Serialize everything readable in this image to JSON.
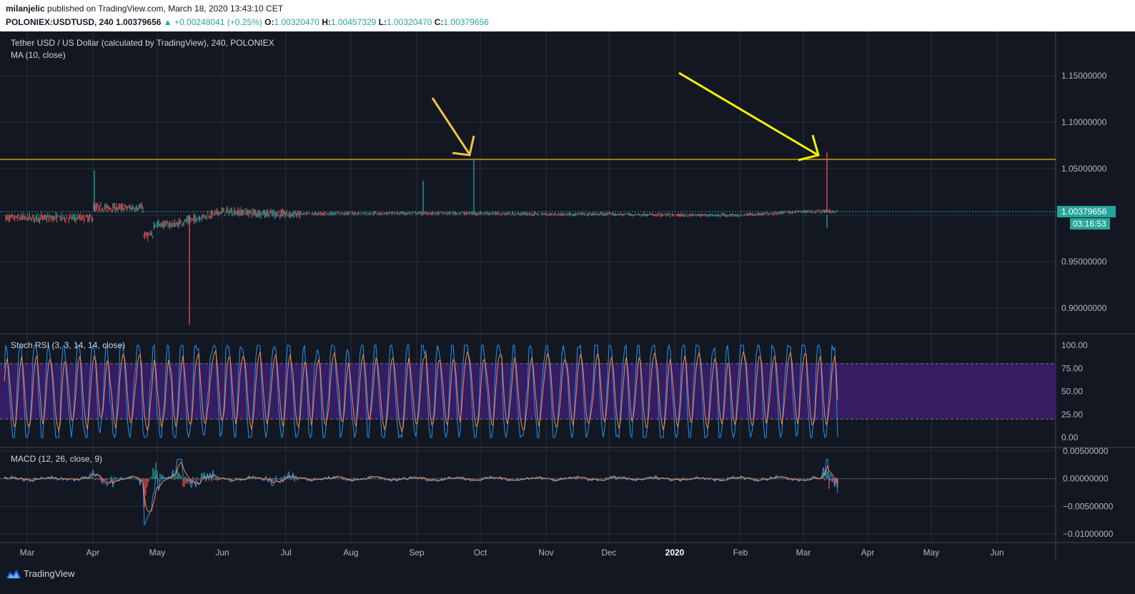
{
  "header": {
    "author": "milanjelic",
    "published_text": "published on TradingView.com, March 18, 2020 13:43:10 CET",
    "symbol": "POLONIEX:USDTUSD, 240",
    "last_price": "1.00379656",
    "change_arrow": "▲",
    "change": "+0.00248041 (+0.25%)",
    "ohlc": [
      {
        "label": "O:",
        "value": "1.00320470"
      },
      {
        "label": "H:",
        "value": "1.00457329"
      },
      {
        "label": "L:",
        "value": "1.00320470"
      },
      {
        "label": "C:",
        "value": "1.00379656"
      }
    ]
  },
  "main_pane": {
    "title": "Tether USD / US Dollar (calculated by TradingView), 240, POLONIEX",
    "indicator": "MA (10, close)",
    "price_labels": [
      "1.15000000",
      "1.10000000",
      "1.05000000",
      "0.95000000",
      "0.90000000"
    ],
    "price_values": [
      1.15,
      1.1,
      1.05,
      0.95,
      0.9
    ],
    "current_price_label": "1.00379656",
    "countdown_label": "03:16:53",
    "horizontal_line_price": 1.06
  },
  "stoch_pane": {
    "title": "Stoch RSI (3, 3, 14, 14, close)",
    "labels": [
      "100.00",
      "75.00",
      "50.00",
      "25.00",
      "0.00"
    ],
    "values": [
      100,
      75,
      50,
      25,
      0
    ],
    "band": [
      20,
      80
    ]
  },
  "macd_pane": {
    "title": "MACD (12, 26, close, 9)",
    "labels": [
      "0.00500000",
      "0.00000000",
      "−0.00500000",
      "−0.01000000"
    ],
    "values": [
      0.005,
      0,
      -0.005,
      -0.01
    ]
  },
  "x_axis": {
    "labels": [
      "Mar",
      "Apr",
      "May",
      "Jun",
      "Jul",
      "Aug",
      "Sep",
      "Oct",
      "Nov",
      "Dec",
      "2020",
      "Feb",
      "Mar",
      "Apr",
      "May",
      "Jun"
    ]
  },
  "branding": {
    "name": "TradingView"
  },
  "colors": {
    "background": "#131722",
    "grid": "#2a2e39",
    "up": "#26a69a",
    "down": "#ef5350",
    "hline": "#f0b90b",
    "arrow1": "#f5c242",
    "arrow2": "#f5f500",
    "stoch_k": "#2196f3",
    "stoch_d": "#ff8a3d",
    "stoch_band": "#3c1d6e",
    "macd_line": "#2196f3",
    "signal_line": "#ff8a3d"
  },
  "chart_data": {
    "type": "line",
    "title": "Tether USD / US Dollar (calculated by TradingView), 240, POLONIEX",
    "x_ticks": [
      "Mar",
      "Apr",
      "May",
      "Jun",
      "Jul",
      "Aug",
      "Sep",
      "Oct",
      "Nov",
      "Dec",
      "2020",
      "Feb",
      "Mar",
      "Apr",
      "May",
      "Jun"
    ],
    "ylim": [
      0.87,
      1.19
    ],
    "series": [
      {
        "x": [
          "Mar",
          "Apr",
          "May",
          "Jun",
          "Jul",
          "Aug",
          "Sep",
          "Oct",
          "Nov",
          "Dec",
          "2020",
          "Feb",
          "Mar"
        ],
        "values": [
          0.997,
          1.008,
          0.985,
          1.004,
          1.001,
          1.002,
          1.002,
          1.002,
          1.001,
          1.001,
          1.0,
          1.0,
          1.004
        ]
      }
    ],
    "spikes": [
      {
        "x": "Apr",
        "high": 1.048
      },
      {
        "x": "May",
        "low": 0.882
      },
      {
        "x": "Sep",
        "high": 1.037
      },
      {
        "x": "Oct",
        "high": 1.061
      },
      {
        "x": "Mar",
        "high": 1.068,
        "low": 0.986
      }
    ],
    "hline": 1.06,
    "grid": true
  }
}
